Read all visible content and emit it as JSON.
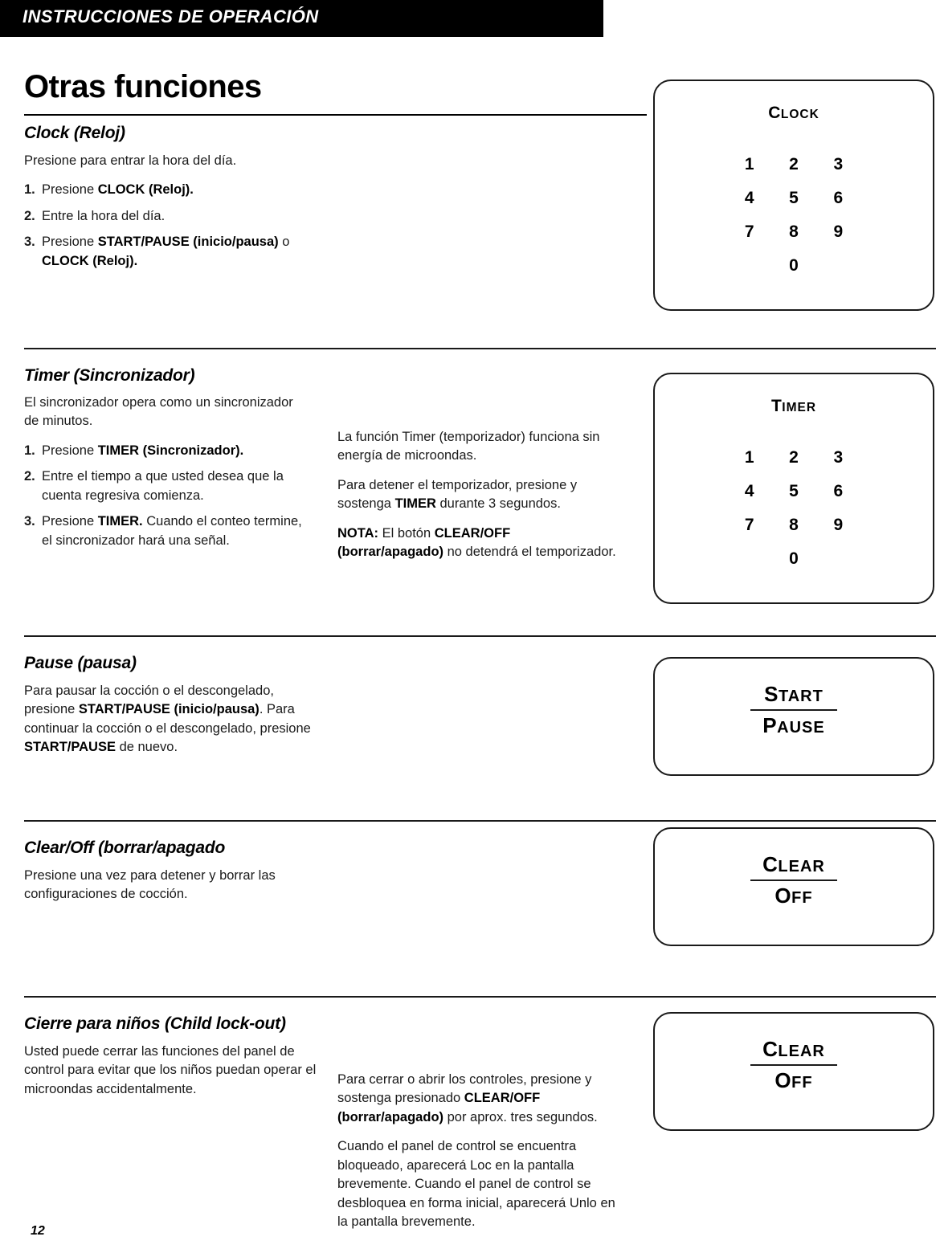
{
  "banner": {
    "title": "INSTRUCCIONES DE OPERACIÓN"
  },
  "page": {
    "main_title": "Otras funciones",
    "page_number": "12"
  },
  "sections": {
    "clock": {
      "heading": "Clock (Reloj)",
      "intro": "Presione para entrar la hora del día.",
      "steps": [
        {
          "num": "1.",
          "text_before": "Presione ",
          "bold": "CLOCK (Reloj).",
          "text_after": ""
        },
        {
          "num": "2.",
          "text_before": "Entre la hora del día.",
          "bold": "",
          "text_after": ""
        },
        {
          "num": "3.",
          "text_before": "Presione ",
          "bold": "START/PAUSE (inicio/pausa)",
          "text_after": " o ",
          "bold2": "CLOCK (Reloj)."
        }
      ]
    },
    "timer": {
      "heading": "Timer (Sincronizador)",
      "intro": "El sincronizador opera como un sincronizador de minutos.",
      "steps": [
        {
          "num": "1.",
          "text_before": "Presione ",
          "bold": "TIMER (Sincronizador).",
          "text_after": ""
        },
        {
          "num": "2.",
          "text_before": "Entre el tiempo a que usted desea que la cuenta regresiva comienza.",
          "bold": "",
          "text_after": ""
        },
        {
          "num": "3.",
          "text_before": "Presione ",
          "bold": "TIMER.",
          "text_after": " Cuando el conteo termine, el sincronizador hará una señal."
        }
      ],
      "col2_p1": "La función Timer (temporizador) funciona sin energía de microondas.",
      "col2_p2_before": "Para detener el temporizador, presione y sostenga ",
      "col2_p2_bold": "TIMER",
      "col2_p2_after": " durante 3 segundos.",
      "col2_p3_note": "NOTA:",
      "col2_p3_before": " El botón ",
      "col2_p3_bold": "CLEAR/OFF (borrar/apagado)",
      "col2_p3_after": " no detendrá el temporizador."
    },
    "pause": {
      "heading": "Pause (pausa)",
      "p1_a": "Para pausar la cocción o el descongelado, presione ",
      "p1_b": "START/PAUSE (inicio/pausa)",
      "p1_c": ". Para continuar la cocción o el descongelado, presione ",
      "p1_d": "START/PAUSE",
      "p1_e": " de nuevo."
    },
    "clearoff": {
      "heading": "Clear/Off (borrar/apagado",
      "p1": "Presione una vez para detener y borrar las configuraciones de cocción."
    },
    "childlock": {
      "heading": "Cierre para niños (Child lock-out)",
      "col1_p1": "Usted puede cerrar las funciones del panel de control para evitar que los niños puedan operar el microondas accidentalmente.",
      "col2_p1_a": "Para cerrar o abrir los controles, presione y sostenga presionado ",
      "col2_p1_b": "CLEAR/OFF (borrar/apagado)",
      "col2_p1_c": " por aprox. tres segundos.",
      "col2_p2": "Cuando el panel de control se encuentra bloqueado, aparecerá Loc en la pantalla brevemente. Cuando el panel de control se desbloquea en forma inicial, aparecerá Unlo en la pantalla brevemente."
    }
  },
  "panels": {
    "clock_keypad": {
      "label_cap": "C",
      "label_rest": "LOCK",
      "keys": [
        "1",
        "2",
        "3",
        "4",
        "5",
        "6",
        "7",
        "8",
        "9"
      ],
      "zero": "0"
    },
    "timer_keypad": {
      "label_cap": "T",
      "label_rest": "IMER",
      "keys": [
        "1",
        "2",
        "3",
        "4",
        "5",
        "6",
        "7",
        "8",
        "9"
      ],
      "zero": "0"
    },
    "start_pause_button": {
      "line1_cap": "S",
      "line1_rest": "TART",
      "line2_cap": "P",
      "line2_rest": "AUSE"
    },
    "clear_off_button": {
      "line1_cap": "C",
      "line1_rest": "LEAR",
      "line2_cap": "O",
      "line2_rest": "FF"
    },
    "clear_off_button_lock": {
      "line1_cap": "C",
      "line1_rest": "LEAR",
      "line2_cap": "O",
      "line2_rest": "FF"
    }
  }
}
